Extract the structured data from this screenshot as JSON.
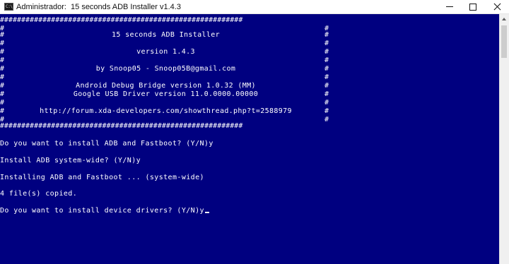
{
  "window": {
    "title": "Administrador:  15 seconds ADB Installer v1.4.3",
    "icon_label": "C:\\"
  },
  "console": {
    "border": "#########################################################",
    "header_lines": [
      "15 seconds ADB Installer",
      "version 1.4.3",
      "by Snoop05 - Snoop05B@gmail.com",
      "Android Debug Bridge version 1.0.32 (MM)",
      "Google USB Driver version 11.0.0000.00000",
      "http://forum.xda-developers.com/showthread.php?t=2588979"
    ],
    "prompts": [
      "Do you want to install ADB and Fastboot? (Y/N)y",
      "Install ADB system-wide? (Y/N)y",
      "Installing ADB and Fastboot ... (system-wide)",
      "4 file(s) copied.",
      "Do you want to install device drivers? (Y/N)y"
    ]
  },
  "colors": {
    "console_background": "#000080",
    "console_text": "#ffffff",
    "titlebar_background": "#ffffff"
  },
  "icons": [
    "cmd-icon",
    "minimize-icon",
    "maximize-icon",
    "close-icon",
    "scroll-up-icon"
  ]
}
